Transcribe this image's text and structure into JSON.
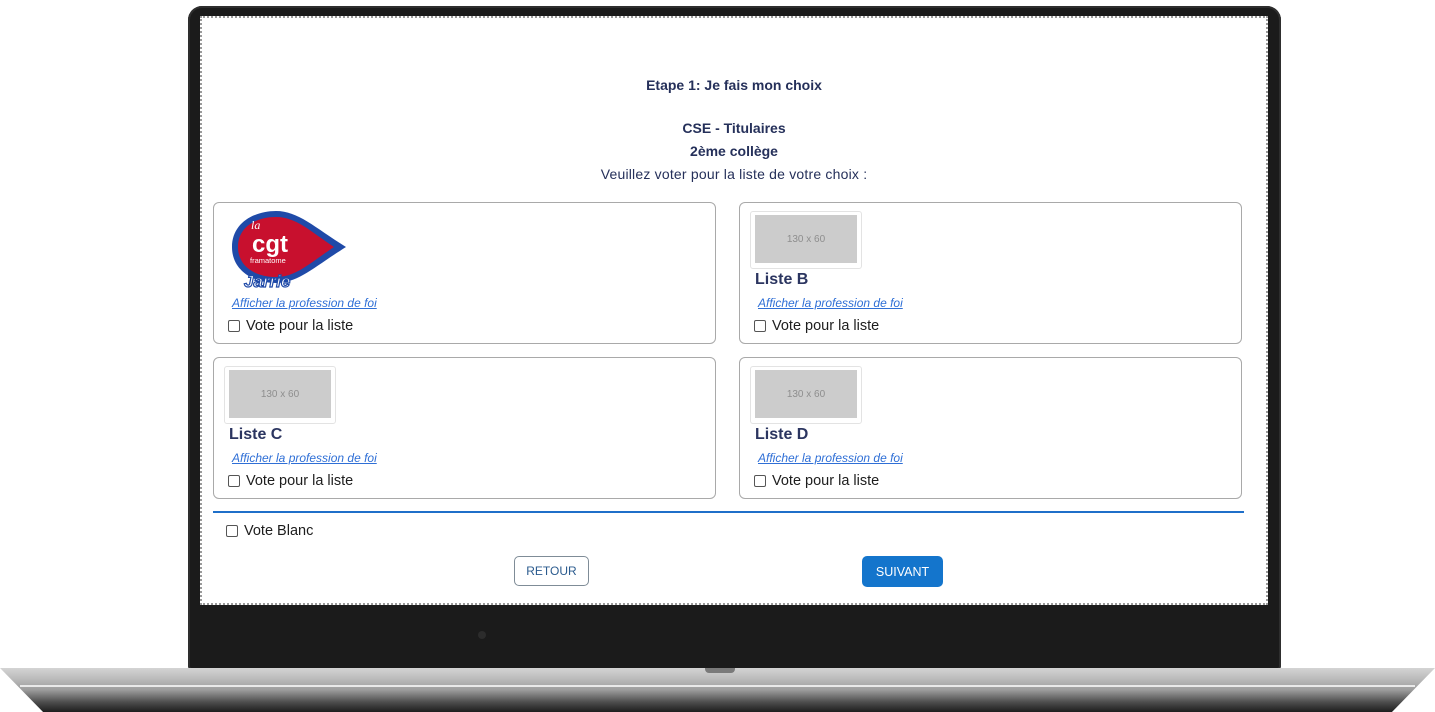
{
  "header": {
    "step_title": "Etape 1: Je fais mon choix",
    "election_title": "CSE - Titulaires",
    "college": "2ème collège",
    "instruction": "Veuillez voter pour la liste de votre choix :"
  },
  "lists": [
    {
      "name": "",
      "logo": {
        "brand_top": "la",
        "brand_main": "cgt",
        "brand_sub": "framatome",
        "brand_site": "Jarrie",
        "colors": {
          "red": "#c8102e",
          "blue": "#1f4aa8"
        }
      },
      "profession_link": "Afficher la profession de foi",
      "vote_label": "Vote pour la liste"
    },
    {
      "name": "Liste B",
      "placeholder": "130 x 60",
      "profession_link": "Afficher la profession de foi",
      "vote_label": "Vote pour la liste"
    },
    {
      "name": "Liste C",
      "placeholder": "130 x 60",
      "profession_link": "Afficher la profession de foi",
      "vote_label": "Vote pour la liste"
    },
    {
      "name": "Liste D",
      "placeholder": "130 x 60",
      "profession_link": "Afficher la profession de foi",
      "vote_label": "Vote pour la liste"
    }
  ],
  "blank_vote_label": "Vote Blanc",
  "buttons": {
    "back": "RETOUR",
    "next": "SUIVANT"
  },
  "colors": {
    "accent": "#1475cc",
    "text_dark": "#25305a",
    "link": "#2f6fd6"
  }
}
